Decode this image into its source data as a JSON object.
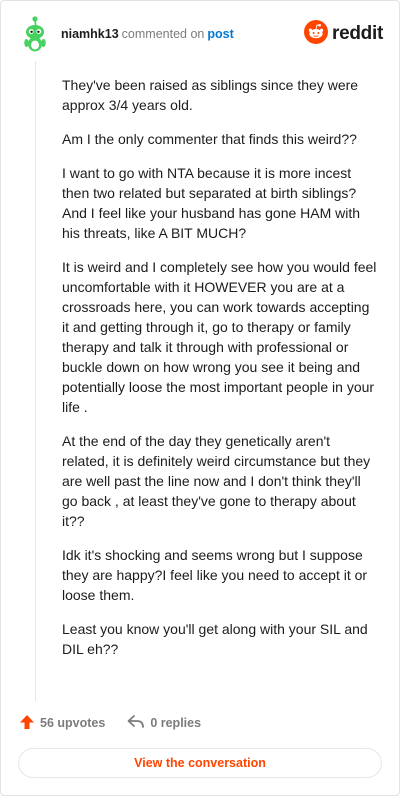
{
  "comment": {
    "username": "niamhk13",
    "commented_on": "commented on",
    "post_link": "post",
    "paragraphs": [
      "They've been raised as siblings since they were approx 3/4 years old.",
      "Am I the only commenter that finds this weird??",
      "I want to go with NTA because it is more incest then two related but separated at birth siblings? And I feel like your husband has gone HAM with his threats, like A BIT MUCH?",
      "It is weird and I completely see how you would feel uncomfortable with it HOWEVER you are at a crossroads here, you can work towards accepting it and getting through it, go to therapy or family therapy and talk it through with professional or buckle down on how wrong you see it being and potentially loose the most important people in your life .",
      "At the end of the day they genetically aren't related, it is definitely weird circumstance but they are well past the line now and I don't think they'll go back , at least they've gone to therapy about it??",
      "Idk it's shocking and seems wrong but I suppose they are happy?I feel like you need to accept it or loose them.",
      "Least you know you'll get along with your SIL and DIL eh??"
    ],
    "upvotes_label": "56 upvotes",
    "replies_label": "0 replies"
  },
  "brand": {
    "name": "reddit",
    "icon": "reddit-snoo-icon"
  },
  "avatar_icon": "snoo-avatar-icon",
  "view_button_label": "View the conversation",
  "colors": {
    "accent": "#ff4500",
    "link": "#0079d3",
    "avatar_green": "#46d160",
    "muted": "#7c7c7c"
  }
}
